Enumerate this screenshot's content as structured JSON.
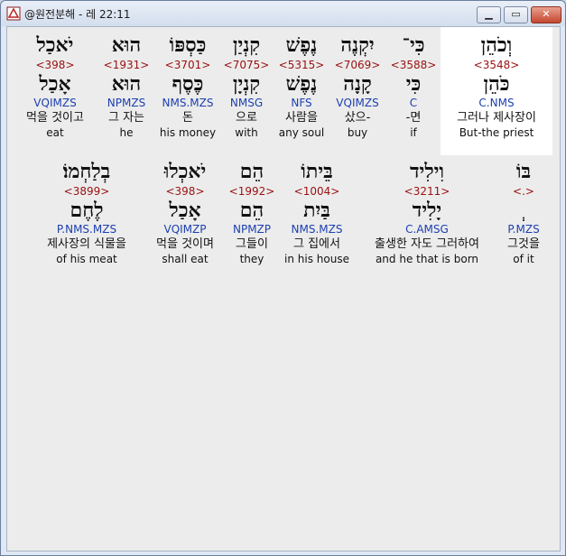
{
  "window": {
    "title": "@원전분해 - 레 22:11",
    "min_icon": "minimize-icon",
    "max_icon": "maximize-icon",
    "close_icon": "close-icon"
  },
  "rows": [
    {
      "words": [
        {
          "hebrew": "וְכֹהֵן",
          "strong": "<3548>",
          "lemma": "כֹּהֵן",
          "morph": "C.NMS",
          "korean": "그러나 제사장이",
          "english": "But-the priest",
          "highlight": true
        },
        {
          "hebrew": "כִּי־",
          "strong": "<3588>",
          "lemma": "כִּי",
          "morph": "C",
          "korean": "-면",
          "english": "if",
          "highlight": false
        },
        {
          "hebrew": "יִקְנֶה",
          "strong": "<7069>",
          "lemma": "קָנָה",
          "morph": "VQIMZS",
          "korean": "샀으-",
          "english": "buy",
          "highlight": false
        },
        {
          "hebrew": "נֶפֶשׁ",
          "strong": "<5315>",
          "lemma": "נֶפֶשׁ",
          "morph": "NFS",
          "korean": "사람을",
          "english": "any soul",
          "highlight": false
        },
        {
          "hebrew": "קִנְיַן",
          "strong": "<7075>",
          "lemma": "קִנְיָן",
          "morph": "NMSG",
          "korean": "으로",
          "english": "with",
          "highlight": false
        },
        {
          "hebrew": "כַּסְפּוֹ",
          "strong": "<3701>",
          "lemma": "כֶּסֶף",
          "morph": "NMS.MZS",
          "korean": "돈",
          "english": "his money",
          "highlight": false
        },
        {
          "hebrew": "הוּא",
          "strong": "<1931>",
          "lemma": "הוּא",
          "morph": "NPMZS",
          "korean": "그 자는",
          "english": "he",
          "highlight": false
        },
        {
          "hebrew": "יֹאכַל",
          "strong": "<398>",
          "lemma": "אָכַל",
          "morph": "VQIMZS",
          "korean": "먹을 것이고",
          "english": "eat",
          "highlight": false
        }
      ]
    },
    {
      "words": [
        {
          "hebrew": "בּוֹ",
          "strong": "<.>",
          "lemma": "ְ",
          "morph": "P.MZS",
          "korean": "그것을",
          "english": "of it",
          "highlight": false
        },
        {
          "hebrew": "וִילִיד",
          "strong": "<3211>",
          "lemma": "יָלִיד",
          "morph": "C.AMSG",
          "korean": "출생한 자도 그러하여",
          "english": "and he that is born",
          "highlight": false
        },
        {
          "hebrew": "בֵּיתוֹ",
          "strong": "<1004>",
          "lemma": "בַּיִת",
          "morph": "NMS.MZS",
          "korean": "그 집에서",
          "english": "in his house",
          "highlight": false
        },
        {
          "hebrew": "הֵם",
          "strong": "<1992>",
          "lemma": "הֵם",
          "morph": "NPMZP",
          "korean": "그들이",
          "english": "they",
          "highlight": false
        },
        {
          "hebrew": "יֹאכְלוּ",
          "strong": "<398>",
          "lemma": "אָכַל",
          "morph": "VQIMZP",
          "korean": "먹을 것이며",
          "english": "shall eat",
          "highlight": false
        },
        {
          "hebrew": "בְלַחְמוֹ׃",
          "strong": "<3899>",
          "lemma": "לֶחֶם",
          "morph": "P.NMS.MZS",
          "korean": "제사장의 식물을",
          "english": "of his meat",
          "highlight": false
        }
      ]
    }
  ]
}
